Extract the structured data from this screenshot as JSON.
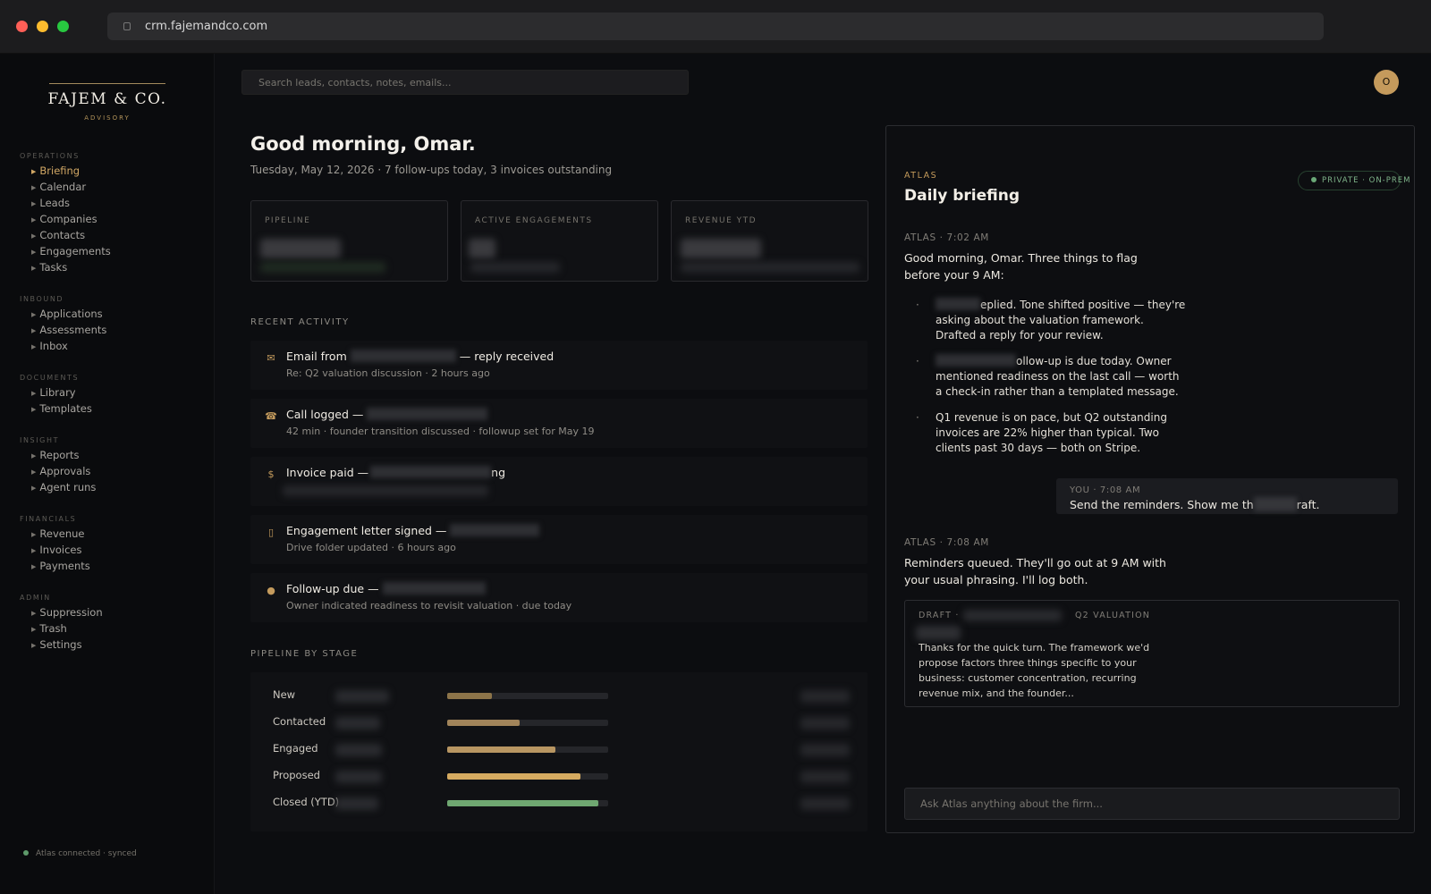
{
  "browser": {
    "url": "crm.fajemandco.com"
  },
  "brand": {
    "name": "FAJEM & CO.",
    "tagline": "ADVISORY"
  },
  "sidebar": {
    "sections": [
      {
        "title": "OPERATIONS",
        "items": [
          "Briefing",
          "Calendar",
          "Leads",
          "Companies",
          "Contacts",
          "Engagements",
          "Tasks"
        ]
      },
      {
        "title": "INBOUND",
        "items": [
          "Applications",
          "Assessments",
          "Inbox"
        ]
      },
      {
        "title": "DOCUMENTS",
        "items": [
          "Library",
          "Templates"
        ]
      },
      {
        "title": "INSIGHT",
        "items": [
          "Reports",
          "Approvals",
          "Agent runs"
        ]
      },
      {
        "title": "FINANCIALS",
        "items": [
          "Revenue",
          "Invoices",
          "Payments"
        ]
      },
      {
        "title": "ADMIN",
        "items": [
          "Suppression",
          "Trash",
          "Settings"
        ]
      }
    ],
    "active_item": "Briefing",
    "status": "Atlas connected · synced"
  },
  "search": {
    "placeholder": "Search leads, contacts, notes, emails..."
  },
  "user": {
    "initial": "O"
  },
  "header": {
    "greeting": "Good morning, Omar.",
    "subline": "Tuesday, May 12, 2026 · 7 follow-ups today, 3 invoices outstanding"
  },
  "kpis": [
    {
      "label": "PIPELINE"
    },
    {
      "label": "ACTIVE ENGAGEMENTS"
    },
    {
      "label": "REVENUE YTD"
    }
  ],
  "activity": {
    "title": "RECENT ACTIVITY",
    "items": [
      {
        "icon": "mail-icon",
        "glyph": "✉",
        "title_prefix": "Email from",
        "title_suffix": "— reply received",
        "sub": "Re: Q2 valuation discussion · 2 hours ago"
      },
      {
        "icon": "phone-icon",
        "glyph": "☎",
        "title_prefix": "Call logged —",
        "title_suffix": "",
        "sub": "42 min · founder transition discussed · followup set for May 19"
      },
      {
        "icon": "dollar-icon",
        "glyph": "$",
        "title_prefix": "Invoice paid —",
        "title_suffix": "ng",
        "sub": ""
      },
      {
        "icon": "document-icon",
        "glyph": "▯",
        "title_prefix": "Engagement letter signed —",
        "title_suffix": "",
        "sub": "Drive folder updated · 6 hours ago"
      },
      {
        "icon": "circle-icon",
        "glyph": "●",
        "title_prefix": "Follow-up due —",
        "title_suffix": "",
        "sub": "Owner indicated readiness to revisit valuation · due today"
      }
    ]
  },
  "pipeline": {
    "title": "PIPELINE BY STAGE",
    "stages": [
      {
        "label": "New",
        "fraction": 0.28,
        "color": "#8c7449"
      },
      {
        "label": "Contacted",
        "fraction": 0.45,
        "color": "#a1845a"
      },
      {
        "label": "Engaged",
        "fraction": 0.67,
        "color": "#b89662"
      },
      {
        "label": "Proposed",
        "fraction": 0.83,
        "color": "#d5aa60"
      },
      {
        "label": "Closed (YTD)",
        "fraction": 0.94,
        "color": "#6fa771"
      }
    ]
  },
  "atlas": {
    "kicker": "ATLAS",
    "title": "Daily briefing",
    "badge": "PRIVATE · ON-PREM",
    "msg1_meta": "ATLAS · 7:02 AM",
    "msg1": "Good morning, Omar. Three things to flag before your 9 AM:",
    "bullets": [
      "eplied. Tone shifted positive — they're asking about the valuation framework. Drafted a reply for your review.",
      "ollow-up is due today. Owner mentioned readiness on the last call — worth a check-in rather than a templated message.",
      "Q1 revenue is on pace, but Q2 outstanding invoices are 22% higher than typical. Two clients past 30 days — both on Stripe."
    ],
    "you_meta": "YOU · 7:08 AM",
    "you_msg_prefix": "Send the reminders. Show me th",
    "you_msg_suffix": "raft.",
    "msg2_meta": "ATLAS · 7:08 AM",
    "msg2": "Reminders queued. They'll go out at 9 AM with your usual phrasing. I'll log both.",
    "draft_label": "DRAFT ·",
    "draft_label2": "Q2 VALUATION",
    "draft_body": "Thanks for the quick turn. The framework we'd propose factors three things specific to your business: customer concentration, recurring revenue mix, and the founder...",
    "ask_placeholder": "Ask Atlas anything about the firm..."
  }
}
